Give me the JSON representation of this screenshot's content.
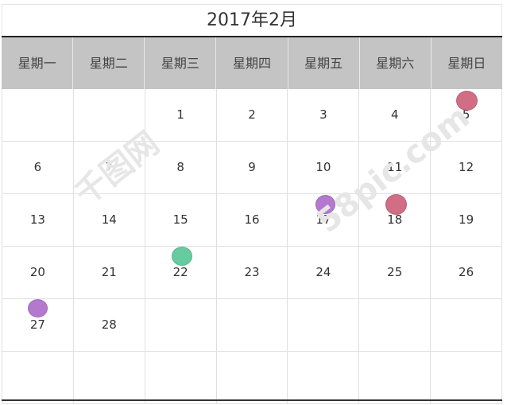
{
  "calendar": {
    "title": "2017年2月",
    "weekdays": [
      "星期一",
      "星期二",
      "星期三",
      "星期四",
      "星期五",
      "星期六",
      "星期日"
    ],
    "weeks": [
      [
        "",
        "",
        "1",
        "2",
        "3",
        "4",
        "5"
      ],
      [
        "6",
        "7",
        "8",
        "9",
        "10",
        "11",
        "12"
      ],
      [
        "13",
        "14",
        "15",
        "16",
        "17",
        "18",
        "19"
      ],
      [
        "20",
        "21",
        "22",
        "23",
        "24",
        "25",
        "26"
      ],
      [
        "27",
        "28",
        "",
        "",
        "",
        "",
        ""
      ],
      [
        "",
        "",
        "",
        "",
        "",
        "",
        ""
      ]
    ],
    "event_markers": [
      {
        "day": "5",
        "color": "#c9546f"
      },
      {
        "day": "17",
        "color": "#a862c7"
      },
      {
        "day": "18",
        "color": "#c9546f"
      },
      {
        "day": "22",
        "color": "#4cc490"
      },
      {
        "day": "27",
        "color": "#a862c7"
      }
    ]
  },
  "watermark": {
    "left": "千图网",
    "right": "58pic.com"
  }
}
